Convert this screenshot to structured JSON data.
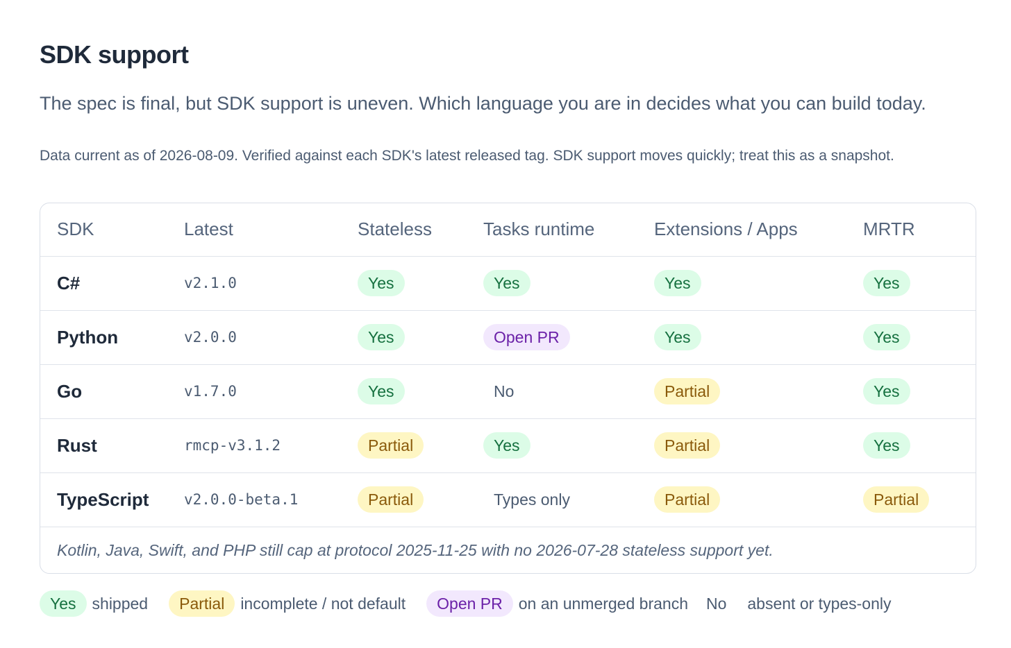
{
  "title": "SDK support",
  "lead": "The spec is final, but SDK support is uneven. Which language you are in decides what you can build today.",
  "note": "Data current as of 2026-08-09. Verified against each SDK's latest released tag. SDK support moves quickly; treat this as a snapshot.",
  "table": {
    "headers": [
      "SDK",
      "Latest",
      "Stateless",
      "Tasks runtime",
      "Extensions / Apps",
      "MRTR"
    ],
    "rows": [
      {
        "sdk": "C#",
        "latest": "v2.1.0",
        "stateless": "Yes",
        "tasks": "Yes",
        "extensions": "Yes",
        "mrtr": "Yes"
      },
      {
        "sdk": "Python",
        "latest": "v2.0.0",
        "stateless": "Yes",
        "tasks": "Open PR",
        "extensions": "Yes",
        "mrtr": "Yes"
      },
      {
        "sdk": "Go",
        "latest": "v1.7.0",
        "stateless": "Yes",
        "tasks": "No",
        "extensions": "Partial",
        "mrtr": "Yes"
      },
      {
        "sdk": "Rust",
        "latest": "rmcp-v3.1.2",
        "stateless": "Partial",
        "tasks": "Yes",
        "extensions": "Partial",
        "mrtr": "Yes"
      },
      {
        "sdk": "TypeScript",
        "latest": "v2.0.0-beta.1",
        "stateless": "Partial",
        "tasks": "Types only",
        "extensions": "Partial",
        "mrtr": "Partial"
      }
    ],
    "footnote": "Kotlin, Java, Swift, and PHP still cap at protocol 2025-11-25 with no 2026-07-28 stateless support yet."
  },
  "legend": [
    {
      "label": "Yes",
      "desc": "shipped"
    },
    {
      "label": "Partial",
      "desc": "incomplete / not default"
    },
    {
      "label": "Open PR",
      "desc": "on an unmerged branch"
    },
    {
      "label": "No",
      "desc": "absent or types-only"
    }
  ],
  "colors": {
    "yes_bg": "#dcfce7",
    "yes_fg": "#15703f",
    "partial_bg": "#fef6c3",
    "partial_fg": "#8a5a0b",
    "openpr_bg": "#f2e8fd",
    "openpr_fg": "#6b21a8"
  }
}
